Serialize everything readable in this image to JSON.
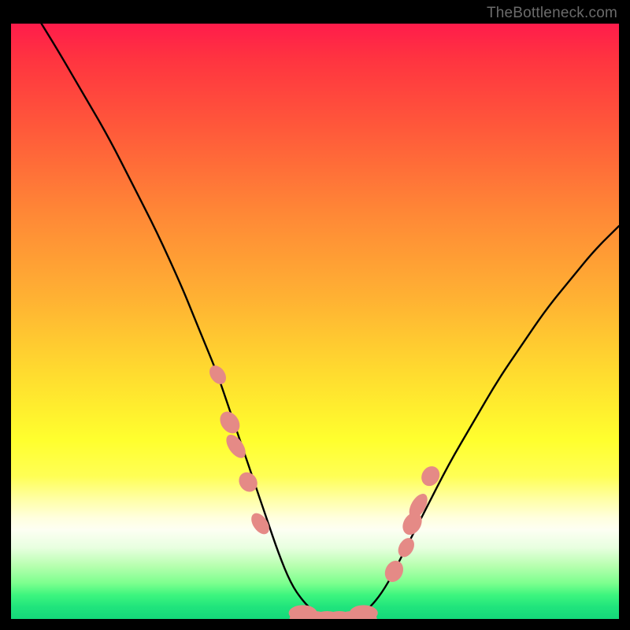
{
  "watermark": "TheBottleneck.com",
  "chart_data": {
    "type": "line",
    "title": "",
    "xlabel": "",
    "ylabel": "",
    "xlim": [
      0,
      100
    ],
    "ylim": [
      0,
      100
    ],
    "series": [
      {
        "name": "bottleneck-curve",
        "x": [
          5,
          8,
          12,
          16,
          20,
          24,
          28,
          30,
          32,
          34,
          36,
          38,
          40,
          42,
          44,
          46,
          48,
          50,
          52,
          54,
          56,
          58,
          60,
          62,
          64,
          68,
          72,
          76,
          80,
          84,
          88,
          92,
          96,
          100
        ],
        "y": [
          100,
          95,
          88,
          81,
          73,
          65,
          56,
          51,
          46,
          41,
          35,
          29,
          23,
          17,
          11,
          6,
          3,
          1,
          0,
          0,
          0,
          1,
          3,
          6,
          10,
          18,
          26,
          33,
          40,
          46,
          52,
          57,
          62,
          66
        ]
      }
    ],
    "markers": {
      "name": "highlighted-points",
      "color": "#e58a86",
      "points": [
        {
          "x": 34,
          "y": 41
        },
        {
          "x": 36,
          "y": 33
        },
        {
          "x": 37,
          "y": 29
        },
        {
          "x": 39,
          "y": 23
        },
        {
          "x": 41,
          "y": 16
        },
        {
          "x": 48,
          "y": 1
        },
        {
          "x": 50,
          "y": 0
        },
        {
          "x": 52,
          "y": 0
        },
        {
          "x": 54,
          "y": 0
        },
        {
          "x": 56,
          "y": 0
        },
        {
          "x": 58,
          "y": 1
        },
        {
          "x": 63,
          "y": 8
        },
        {
          "x": 65,
          "y": 12
        },
        {
          "x": 66,
          "y": 16
        },
        {
          "x": 67,
          "y": 19
        },
        {
          "x": 69,
          "y": 24
        }
      ]
    },
    "background_gradient": {
      "top": "#ff1c4b",
      "mid": "#ffff2e",
      "bottom": "#14d87a"
    }
  }
}
